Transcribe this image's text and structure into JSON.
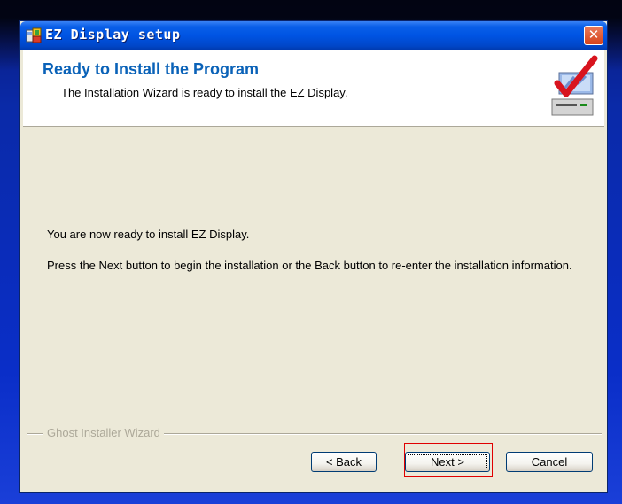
{
  "window": {
    "title": "EZ Display setup",
    "close_symbol": "✕",
    "icon": "setup-icon"
  },
  "header": {
    "title": "Ready to Install the Program",
    "subtitle": "The Installation Wizard is ready to install the EZ Display.",
    "graphic": "install-checkmark-icon"
  },
  "body": {
    "line1": "You are now ready to install EZ Display.",
    "line2": "Press the Next button to begin the installation or the Back button to re-enter the installation information."
  },
  "footer": {
    "label": "Ghost Installer Wizard"
  },
  "buttons": {
    "back": "< Back",
    "next": "Next >",
    "cancel": "Cancel"
  },
  "colors": {
    "titlebar": "#0054e3",
    "header_title": "#0a62b8",
    "dialog_bg": "#ece9d8",
    "highlight": "#e00000"
  }
}
